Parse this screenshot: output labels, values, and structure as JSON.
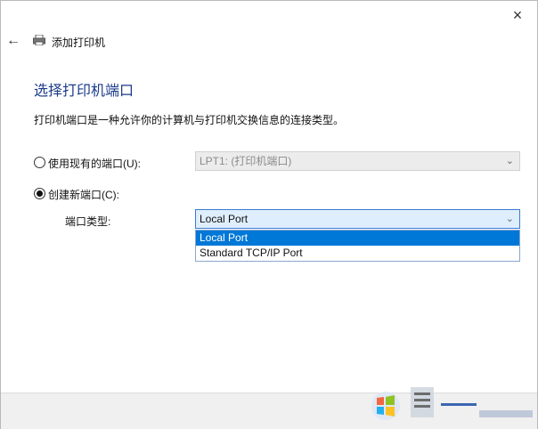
{
  "window": {
    "title": "添加打印机",
    "close_glyph": "×",
    "back_glyph": "←"
  },
  "main": {
    "heading": "选择打印机端口",
    "description": "打印机端口是一种允许你的计算机与打印机交换信息的连接类型。"
  },
  "options": {
    "existing_label": "使用现有的端口(U):",
    "existing_value": "LPT1: (打印机端口)",
    "new_label": "创建新端口(C):",
    "port_type_label": "端口类型:",
    "port_type_value": "Local Port",
    "selected": "new"
  },
  "dropdown": {
    "items": [
      "Local Port",
      "Standard TCP/IP Port"
    ],
    "highlighted_index": 0
  },
  "icons": {
    "back": "back-arrow-icon",
    "printer": "printer-icon",
    "close": "close-icon",
    "chevron": "chevron-down-icon"
  }
}
